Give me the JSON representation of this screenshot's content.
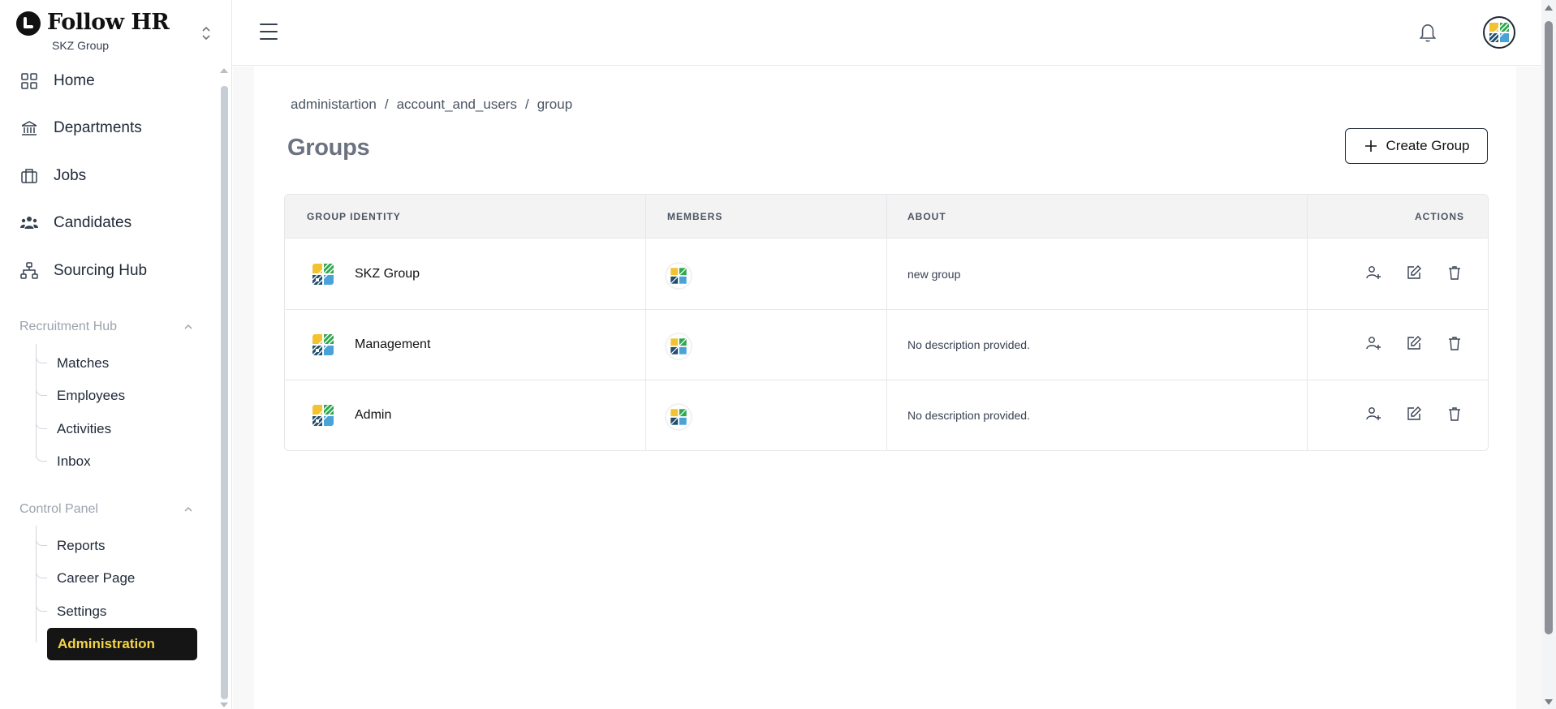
{
  "brand": {
    "name": "Follow HR",
    "workspace": "SKZ Group"
  },
  "sidebar": {
    "items": [
      {
        "label": "Home",
        "icon": "grid-icon"
      },
      {
        "label": "Departments",
        "icon": "bank-icon"
      },
      {
        "label": "Jobs",
        "icon": "briefcase-icon"
      },
      {
        "label": "Candidates",
        "icon": "users-icon"
      },
      {
        "label": "Sourcing Hub",
        "icon": "hierarchy-icon"
      }
    ],
    "recruitment": {
      "title": "Recruitment Hub",
      "items": [
        "Matches",
        "Employees",
        "Activities",
        "Inbox"
      ]
    },
    "control": {
      "title": "Control Panel",
      "items": [
        "Reports",
        "Career Page",
        "Settings",
        "Administration"
      ],
      "active": "Administration"
    }
  },
  "breadcrumb": [
    "administartion",
    "account_and_users",
    "group"
  ],
  "page": {
    "title": "Groups",
    "create_label": "Create Group"
  },
  "table": {
    "columns": [
      "GROUP IDENTITY",
      "MEMBERS",
      "ABOUT",
      "ACTIONS"
    ],
    "rows": [
      {
        "name": "SKZ Group",
        "about": "new group"
      },
      {
        "name": "Management",
        "about": "No description provided."
      },
      {
        "name": "Admin",
        "about": "No description provided."
      }
    ]
  },
  "colors": {
    "active_bg": "#151515",
    "active_text": "#f5d547",
    "logo_blue": "#1e4d6b",
    "logo_green": "#2fa84f",
    "logo_yellow": "#f2c230"
  }
}
